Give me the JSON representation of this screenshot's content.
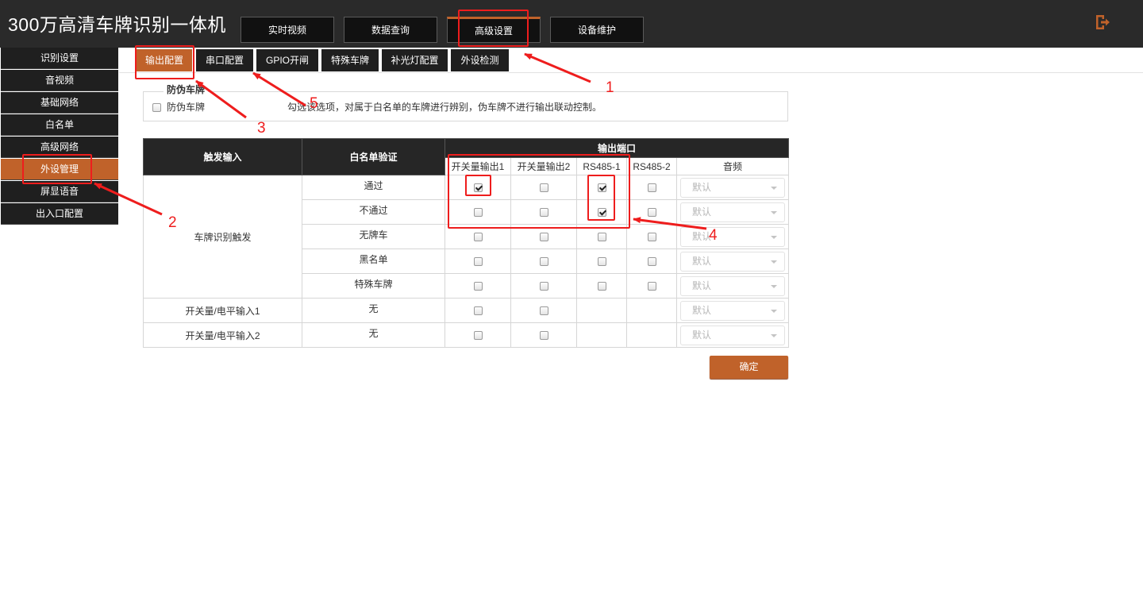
{
  "header": {
    "title": "300万高清车牌识别一体机",
    "nav": [
      {
        "label": "实时视频",
        "active": false
      },
      {
        "label": "数据查询",
        "active": false
      },
      {
        "label": "高级设置",
        "active": true
      },
      {
        "label": "设备维护",
        "active": false
      }
    ],
    "logout_icon": "logout-icon"
  },
  "sidebar": {
    "items": [
      {
        "label": "识别设置",
        "active": false
      },
      {
        "label": "音视频",
        "active": false
      },
      {
        "label": "基础网络",
        "active": false
      },
      {
        "label": "白名单",
        "active": false
      },
      {
        "label": "高级网络",
        "active": false
      },
      {
        "label": "外设管理",
        "active": true
      },
      {
        "label": "屏显语音",
        "active": false
      },
      {
        "label": "出入口配置",
        "active": false
      }
    ]
  },
  "subtabs": [
    {
      "label": "输出配置",
      "active": true
    },
    {
      "label": "串口配置",
      "active": false
    },
    {
      "label": "GPIO开闸",
      "active": false
    },
    {
      "label": "特殊车牌",
      "active": false
    },
    {
      "label": "补光灯配置",
      "active": false
    },
    {
      "label": "外设检测",
      "active": false
    }
  ],
  "fake_plate": {
    "legend": "防伪车牌",
    "checkbox_label": "防伪车牌",
    "checked": false,
    "description": "勾选该选项，对属于白名单的车牌进行辨别，伪车牌不进行输出联动控制。"
  },
  "table": {
    "headers": {
      "trigger": "触发输入",
      "whitelist": "白名单验证",
      "output_ports": "输出端口",
      "ports": [
        "开关量输出1",
        "开关量输出2",
        "RS485-1",
        "RS485-2",
        "音频"
      ]
    },
    "groups": [
      {
        "trigger": "车牌识别触发",
        "rows": [
          {
            "whitelist": "通过",
            "checks": [
              true,
              false,
              true,
              false
            ],
            "audio": "默认"
          },
          {
            "whitelist": "不通过",
            "checks": [
              false,
              false,
              true,
              false
            ],
            "audio": "默认"
          },
          {
            "whitelist": "无牌车",
            "checks": [
              false,
              false,
              false,
              false
            ],
            "audio": "默认"
          },
          {
            "whitelist": "黑名单",
            "checks": [
              false,
              false,
              false,
              false
            ],
            "audio": "默认"
          },
          {
            "whitelist": "特殊车牌",
            "checks": [
              false,
              false,
              false,
              false
            ],
            "audio": "默认"
          }
        ]
      },
      {
        "trigger": "开关量/电平输入1",
        "rows": [
          {
            "whitelist": "无",
            "checks": [
              false,
              false
            ],
            "audio": "默认"
          }
        ]
      },
      {
        "trigger": "开关量/电平输入2",
        "rows": [
          {
            "whitelist": "无",
            "checks": [
              false,
              false
            ],
            "audio": "默认"
          }
        ]
      }
    ]
  },
  "confirm_label": "确定",
  "annotations": {
    "color": "#ee1d1d",
    "numbers": [
      "1",
      "2",
      "3",
      "4",
      "5"
    ]
  }
}
